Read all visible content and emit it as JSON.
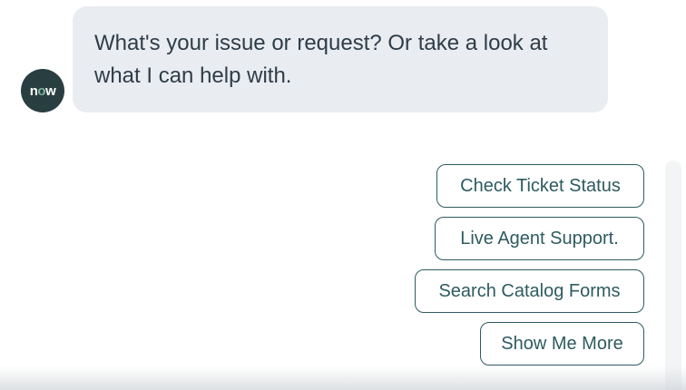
{
  "agent": {
    "avatar_text_n": "n",
    "avatar_text_o": "o",
    "avatar_text_w": "w",
    "message": "What's your issue or request? Or take a look at what I can help with."
  },
  "suggestions": [
    {
      "label": "Check Ticket Status"
    },
    {
      "label": "Live Agent Support."
    },
    {
      "label": "Search Catalog Forms"
    },
    {
      "label": "Show Me More"
    }
  ],
  "colors": {
    "bubble_background": "#e9ecf0",
    "avatar_background": "#293e40",
    "button_border": "#2e5b60",
    "text": "#2e3d49"
  }
}
